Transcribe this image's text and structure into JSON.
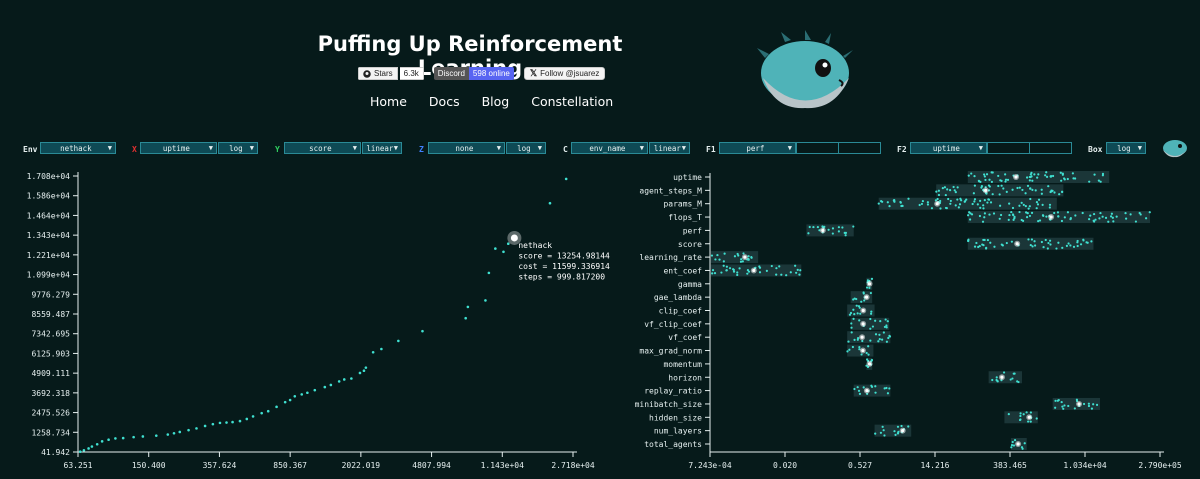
{
  "header": {
    "title": "Puffing Up Reinforcement Learning",
    "badges": {
      "github_label": "Stars",
      "github_count": "6.3k",
      "discord_label": "Discord",
      "discord_count": "598 online",
      "x_label": "Follow @jsuarez"
    },
    "nav": [
      "Home",
      "Docs",
      "Blog",
      "Constellation"
    ]
  },
  "controls": {
    "env": {
      "label": "Env",
      "value": "nethack"
    },
    "x": {
      "label": "X",
      "value": "uptime",
      "scale": "log",
      "color": "#e33030"
    },
    "y": {
      "label": "Y",
      "value": "score",
      "scale": "linear",
      "color": "#30d060"
    },
    "z": {
      "label": "Z",
      "value": "none",
      "scale": "log",
      "color": "#4080ff"
    },
    "c": {
      "label": "C",
      "value": "env_name",
      "scale": "linear"
    },
    "f1": {
      "label": "F1",
      "value": "perf"
    },
    "f2": {
      "label": "F2",
      "value": "uptime"
    },
    "box": {
      "label": "Box",
      "value": "log"
    }
  },
  "chart_data": [
    {
      "type": "scatter",
      "title": "",
      "xlabel": "",
      "ylabel": "",
      "x_scale": "log",
      "y_scale": "linear",
      "x_ticks": [
        "63.251",
        "150.400",
        "357.624",
        "850.367",
        "2022.019",
        "4807.994",
        "1.143e+04",
        "2.718e+04"
      ],
      "y_ticks": [
        "41.942",
        "1258.734",
        "2475.526",
        "3692.318",
        "4909.111",
        "6125.903",
        "7342.695",
        "8559.487",
        "9776.279",
        "1.099e+04",
        "1.221e+04",
        "1.343e+04",
        "1.464e+04",
        "1.586e+04",
        "1.708e+04"
      ],
      "xlim": [
        63.251,
        27180
      ],
      "ylim": [
        41.942,
        17080
      ],
      "points": [
        [
          65,
          60
        ],
        [
          68,
          150
        ],
        [
          72,
          260
        ],
        [
          75,
          380
        ],
        [
          80,
          520
        ],
        [
          85,
          700
        ],
        [
          92,
          800
        ],
        [
          100,
          880
        ],
        [
          110,
          900
        ],
        [
          125,
          960
        ],
        [
          140,
          1000
        ],
        [
          165,
          1050
        ],
        [
          190,
          1120
        ],
        [
          205,
          1200
        ],
        [
          220,
          1280
        ],
        [
          245,
          1390
        ],
        [
          270,
          1500
        ],
        [
          300,
          1650
        ],
        [
          330,
          1760
        ],
        [
          360,
          1840
        ],
        [
          390,
          1860
        ],
        [
          420,
          1890
        ],
        [
          460,
          1950
        ],
        [
          500,
          2080
        ],
        [
          540,
          2240
        ],
        [
          600,
          2440
        ],
        [
          650,
          2560
        ],
        [
          720,
          2830
        ],
        [
          800,
          3120
        ],
        [
          850,
          3250
        ],
        [
          900,
          3480
        ],
        [
          980,
          3600
        ],
        [
          1050,
          3700
        ],
        [
          1150,
          3860
        ],
        [
          1300,
          4050
        ],
        [
          1400,
          4180
        ],
        [
          1550,
          4400
        ],
        [
          1650,
          4520
        ],
        [
          1800,
          4580
        ],
        [
          2000,
          4920
        ],
        [
          2100,
          5060
        ],
        [
          2150,
          5250
        ],
        [
          2350,
          6200
        ],
        [
          2600,
          6400
        ],
        [
          3200,
          6900
        ],
        [
          4300,
          7500
        ],
        [
          7300,
          8300
        ],
        [
          7500,
          9000
        ],
        [
          9300,
          9400
        ],
        [
          9700,
          11100
        ],
        [
          10500,
          12600
        ],
        [
          11600,
          12400
        ],
        [
          12300,
          12900
        ],
        [
          13254.98,
          13254.98
        ],
        [
          20500,
          15400
        ],
        [
          25000,
          16900
        ]
      ],
      "highlight": {
        "env": "nethack",
        "score": "13254.981445",
        "cost": "11599.336914",
        "steps": "999.817200"
      }
    },
    {
      "type": "box",
      "title": "",
      "x_scale": "log",
      "x_ticks": [
        "7.243e-04",
        "0.020",
        "0.527",
        "14.216",
        "383.465",
        "1.034e+04",
        "2.790e+05"
      ],
      "xlim": [
        0.0007243,
        279000
      ],
      "categories": [
        "uptime",
        "agent_steps_M",
        "params_M",
        "flops_T",
        "perf",
        "score",
        "learning_rate",
        "ent_coef",
        "gamma",
        "gae_lambda",
        "clip_coef",
        "vf_clip_coef",
        "vf_coef",
        "max_grad_norm",
        "momentum",
        "horizon",
        "replay_ratio",
        "minibatch_size",
        "hidden_size",
        "num_layers",
        "total_agents"
      ],
      "ranges": [
        [
          60,
          30000
        ],
        [
          15,
          4000
        ],
        [
          1.2,
          3000
        ],
        [
          60,
          180000
        ],
        [
          0.05,
          0.4
        ],
        [
          60,
          15000
        ],
        [
          0.00075,
          0.006
        ],
        [
          0.00075,
          0.04
        ],
        [
          0.7,
          0.9
        ],
        [
          0.35,
          0.9
        ],
        [
          0.3,
          1.0
        ],
        [
          0.35,
          1.9
        ],
        [
          0.3,
          2.0
        ],
        [
          0.3,
          0.95
        ],
        [
          0.7,
          0.9
        ],
        [
          150,
          650
        ],
        [
          0.4,
          2.0
        ],
        [
          2500,
          20000
        ],
        [
          300,
          1300
        ],
        [
          1.0,
          5.0
        ],
        [
          400,
          800
        ]
      ]
    }
  ]
}
